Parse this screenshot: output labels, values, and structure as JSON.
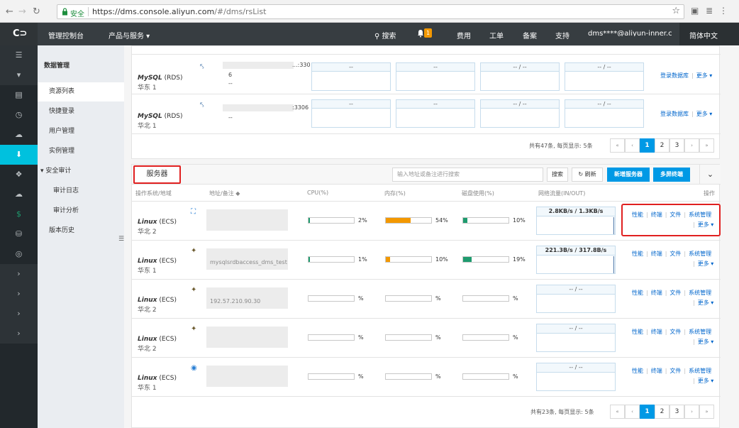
{
  "browser": {
    "secure_label": "安全",
    "url_host": "https://dms.console.aliyun.com",
    "url_path": "/#/dms/rsList"
  },
  "topnav": {
    "logo": "C⊃",
    "console": "管理控制台",
    "products": "产品与服务 ▾",
    "search": "搜索",
    "badge": "1",
    "fees": "费用",
    "tickets": "工单",
    "icp": "备案",
    "support": "支持",
    "user": "dms****@aliyun-inner.com",
    "language": "简体中文"
  },
  "sidebar": {
    "title": "数据管理",
    "items": [
      "资源列表",
      "快捷登录",
      "用户管理",
      "实例管理",
      "安全审计",
      "审计日志",
      "审计分析",
      "版本历史"
    ]
  },
  "db_rows": [
    {
      "type": "MySQL",
      "suffix": " (RDS)",
      "region": "华东 1",
      "addr_tail": "...:330",
      "addr_line2": "6",
      "addr_line3": "--",
      "cpu": "--",
      "mem": "--",
      "disk": "-- / --",
      "net": "-- / --"
    },
    {
      "type": "MySQL",
      "suffix": " (RDS)",
      "region": "华北 1",
      "addr_tail": ":3306",
      "addr_line2": "",
      "addr_line3": "--",
      "cpu": "--",
      "mem": "--",
      "disk": "-- / --",
      "net": "-- / --"
    }
  ],
  "db_actions": {
    "login": "登录数据库",
    "more": "更多 ▾"
  },
  "db_pager": {
    "info": "共有47条,  每页显示: 5条",
    "first": "«",
    "prev": "‹",
    "p1": "1",
    "p2": "2",
    "p3": "3",
    "next": "›",
    "last": "»"
  },
  "servers": {
    "title": "服务器",
    "search_placeholder": "输入地址或备注进行搜索",
    "search_btn": "搜索",
    "refresh_btn": "刷新",
    "add_btn": "新增服务器",
    "multi_btn": "多屏终端",
    "cols": {
      "os": "操作系统/地域",
      "addr": "地址/备注 ◆",
      "cpu": "CPU(%)",
      "mem": "内存(%)",
      "disk": "磁盘使用(%)",
      "net": "网络流量(IN/OUT)",
      "ops": "操作"
    },
    "actions": {
      "perf": "性能",
      "term": "终端",
      "file": "文件",
      "sys": "系统管理",
      "more": "更多 ▾"
    },
    "rows": [
      {
        "type": "Linux",
        "suffix": " (ECS)",
        "region": "华北 2",
        "addr_text": "",
        "cpu": 2,
        "cpu_label": "2%",
        "mem": 54,
        "mem_label": "54%",
        "disk": 10,
        "disk_label": "10%",
        "net": "2.8KB/s / 1.3KB/s"
      },
      {
        "type": "Linux",
        "suffix": " (ECS)",
        "region": "华东 1",
        "addr_text": "mysqlsrdbaccess_dms_test",
        "cpu": 1,
        "cpu_label": "1%",
        "mem": 10,
        "mem_label": "10%",
        "disk": 19,
        "disk_label": "19%",
        "net": "221.3B/s / 317.8B/s"
      },
      {
        "type": "Linux",
        "suffix": " (ECS)",
        "region": "华北 2",
        "addr_text": "192.57.210.90.30",
        "cpu": 0,
        "cpu_label": "%",
        "mem": 0,
        "mem_label": "%",
        "disk": 0,
        "disk_label": "%",
        "net": "-- / --"
      },
      {
        "type": "Linux",
        "suffix": " (ECS)",
        "region": "华北 2",
        "addr_text": "",
        "cpu": 0,
        "cpu_label": "%",
        "mem": 0,
        "mem_label": "%",
        "disk": 0,
        "disk_label": "%",
        "net": "-- / --"
      },
      {
        "type": "Linux",
        "suffix": " (ECS)",
        "region": "华东 1",
        "addr_text": "",
        "cpu": 0,
        "cpu_label": "%",
        "mem": 0,
        "mem_label": "%",
        "disk": 0,
        "disk_label": "%",
        "net": "-- / --"
      }
    ],
    "pager": {
      "info": "共有23条,  每页显示: 5条",
      "first": "«",
      "prev": "‹",
      "p1": "1",
      "p2": "2",
      "p3": "3",
      "next": "›",
      "last": "»"
    }
  },
  "colors": {
    "cpu_bar": "#1e9b6e",
    "mem_bar": "#f39800",
    "disk_bar": "#1e9b6e",
    "accent": "#0099e5",
    "highlight": "#e02020"
  }
}
